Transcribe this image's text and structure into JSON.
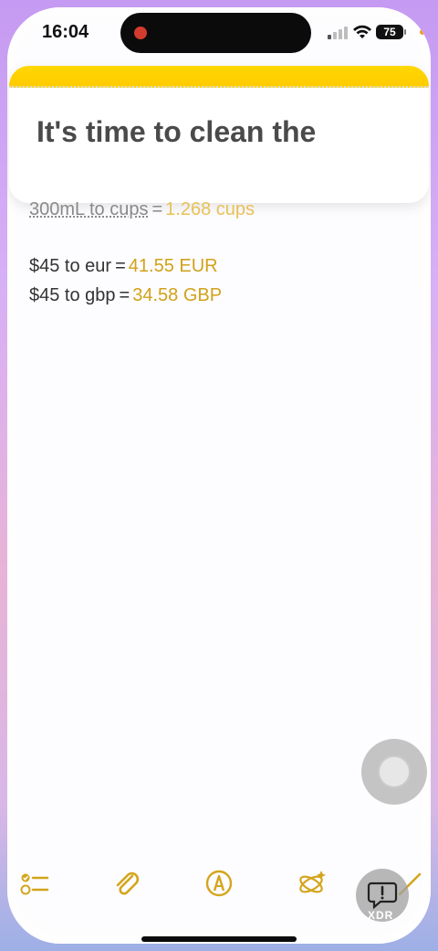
{
  "status_bar": {
    "time": "16:04",
    "battery": "75"
  },
  "note": {
    "title": "It's time to clean the",
    "lines": [
      {
        "expr": "300mL to cups",
        "eq": "=",
        "result": "1.268 cups"
      },
      {
        "expr": "$45 to eur",
        "eq": "=",
        "result": "41.55 EUR"
      },
      {
        "expr": "$45 to gbp",
        "eq": "=",
        "result": "34.58 GBP"
      }
    ]
  },
  "toolbar": {
    "icons": [
      "checklist-icon",
      "paperclip-icon",
      "markup-pen-icon",
      "apple-intelligence-icon",
      "compose-icon"
    ]
  },
  "watermark": "XDR",
  "colors": {
    "accent": "#d1a21a",
    "note_strip": "#ffd000"
  }
}
